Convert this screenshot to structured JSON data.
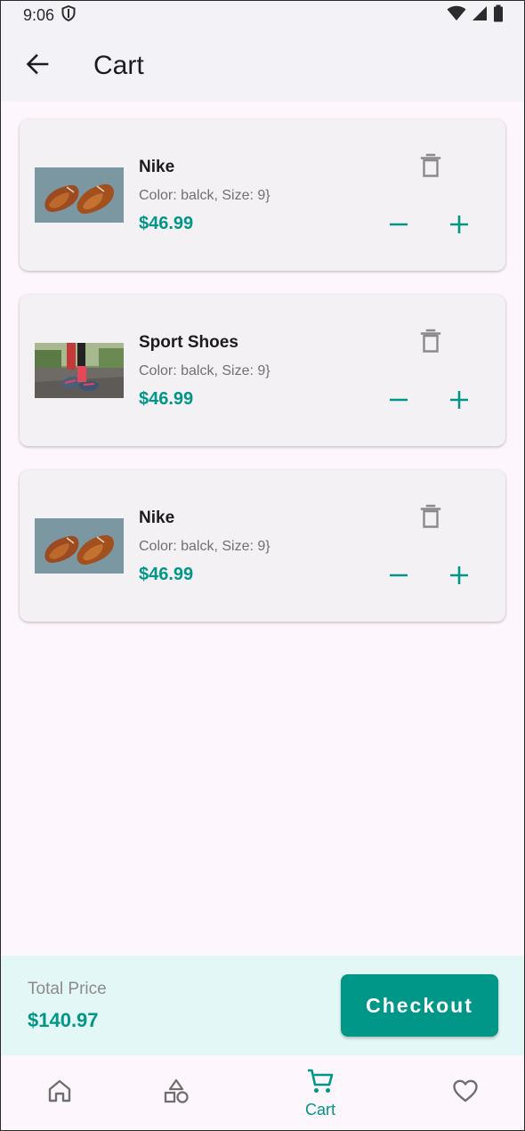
{
  "status_bar": {
    "time": "9:06",
    "icons": [
      "shield-icon",
      "wifi-icon",
      "signal-icon",
      "battery-icon"
    ]
  },
  "app_bar": {
    "title": "Cart",
    "back_icon": "arrow-left-icon"
  },
  "cart": {
    "items": [
      {
        "name": "Nike",
        "attributes": "Color: balck, Size: 9}",
        "price": "$46.99",
        "image": "brown-leather-shoes"
      },
      {
        "name": "Sport Shoes",
        "attributes": "Color: balck, Size: 9}",
        "price": "$46.99",
        "image": "runner-sport-shoes"
      },
      {
        "name": "Nike",
        "attributes": "Color: balck, Size: 9}",
        "price": "$46.99",
        "image": "brown-leather-shoes"
      }
    ]
  },
  "checkout": {
    "total_label": "Total Price",
    "total_value": "$140.97",
    "button_label": "Checkout"
  },
  "bottom_nav": {
    "items": [
      {
        "icon": "home-icon",
        "label": "",
        "active": false
      },
      {
        "icon": "categories-icon",
        "label": "",
        "active": false
      },
      {
        "icon": "cart-icon",
        "label": "Cart",
        "active": true
      },
      {
        "icon": "heart-icon",
        "label": "",
        "active": false
      }
    ]
  },
  "colors": {
    "accent": "#009688",
    "background": "#fdf7fd",
    "card": "#f4f1f5",
    "checkout_bar": "#e3f8f6"
  }
}
